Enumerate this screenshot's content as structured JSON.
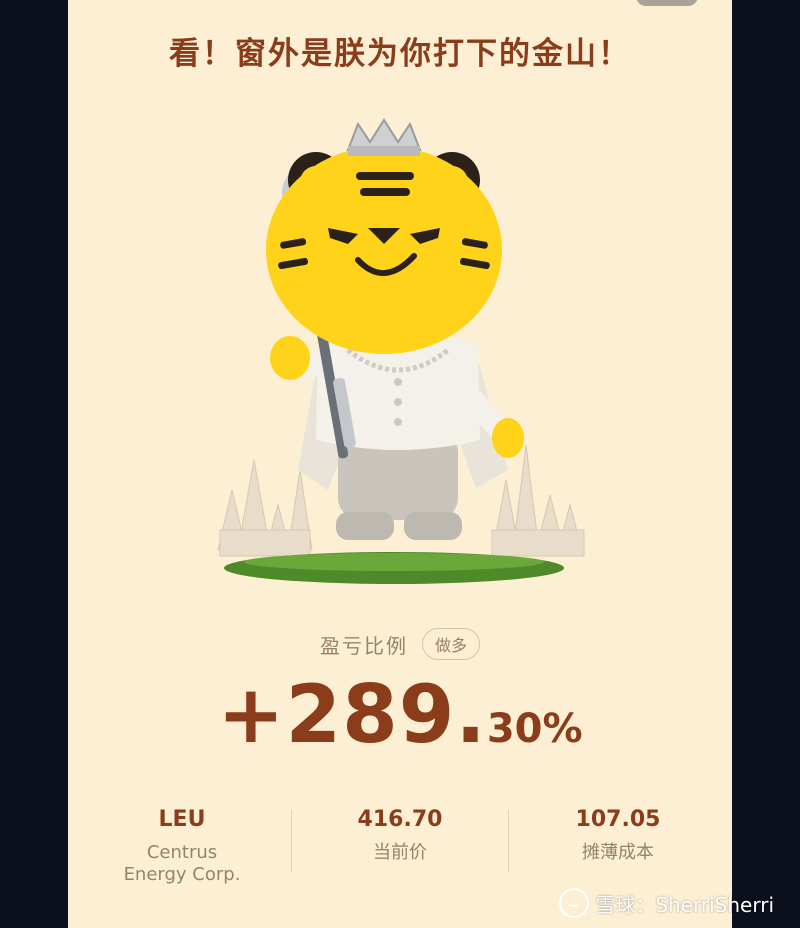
{
  "headline": "看！窗外是朕为你打下的金山！",
  "pnl": {
    "label": "盈亏比例",
    "tag": "做多",
    "value_main": "+289.",
    "value_decimal": "30%"
  },
  "stats": [
    {
      "value": "LEU",
      "label_line1": "Centrus",
      "label_line2": "Energy Corp."
    },
    {
      "value": "416.70",
      "label_line1": "当前价"
    },
    {
      "value": "107.05",
      "label_line1": "摊薄成本"
    }
  ],
  "watermark": {
    "text": "雪球：SherriSherri"
  },
  "colors": {
    "background": "#fcefd3",
    "accent": "#8a3c1b",
    "muted": "#9a8268",
    "mascot_yellow": "#ffd31a"
  },
  "icons": [
    "tiger-king-mascot",
    "xueqiu-logo-icon"
  ]
}
